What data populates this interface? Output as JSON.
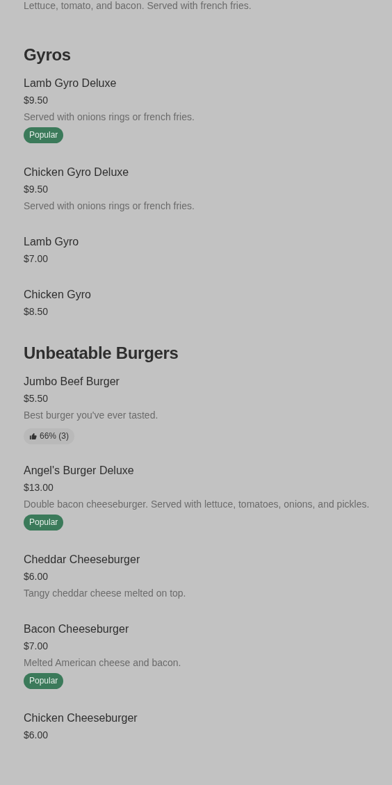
{
  "previous_item_description": "Lettuce, tomato, and bacon. Served with french fries.",
  "sections": [
    {
      "title": "Gyros",
      "items": [
        {
          "name": "Lamb Gyro Deluxe",
          "price": "$9.50",
          "description": "Served with onions rings or french fries.",
          "badge": {
            "kind": "popular",
            "text": "Popular"
          }
        },
        {
          "name": "Chicken Gyro Deluxe",
          "price": "$9.50",
          "description": "Served with onions rings or french fries."
        },
        {
          "name": "Lamb Gyro",
          "price": "$7.00"
        },
        {
          "name": "Chicken Gyro",
          "price": "$8.50"
        }
      ]
    },
    {
      "title": "Unbeatable Burgers",
      "items": [
        {
          "name": "Jumbo Beef Burger",
          "price": "$5.50",
          "description": "Best burger you've ever tasted.",
          "badge": {
            "kind": "rating",
            "text": "66% (3)"
          }
        },
        {
          "name": "Angel's Burger Deluxe",
          "price": "$13.00",
          "description": "Double bacon cheeseburger. Served with lettuce, tomatoes, onions, and pickles.",
          "badge": {
            "kind": "popular",
            "text": "Popular"
          }
        },
        {
          "name": "Cheddar Cheeseburger",
          "price": "$6.00",
          "description": "Tangy cheddar cheese melted on top."
        },
        {
          "name": "Bacon Cheeseburger",
          "price": "$7.00",
          "description": "Melted American cheese and bacon.",
          "badge": {
            "kind": "popular",
            "text": "Popular"
          }
        },
        {
          "name": "Chicken Cheeseburger",
          "price": "$6.00"
        }
      ]
    }
  ]
}
